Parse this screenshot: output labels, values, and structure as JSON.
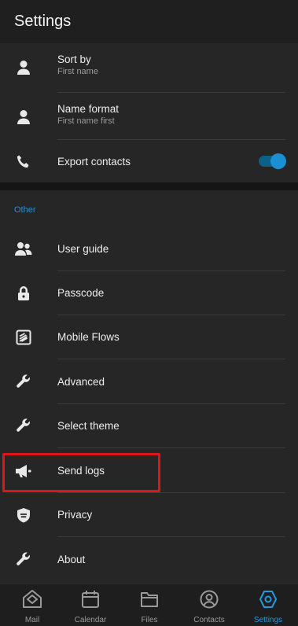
{
  "header": {
    "title": "Settings"
  },
  "contacts_settings": {
    "sort_by": {
      "label": "Sort by",
      "value": "First name"
    },
    "name_format": {
      "label": "Name format",
      "value": "First name first"
    },
    "export_contacts": {
      "label": "Export contacts",
      "enabled": true
    }
  },
  "other": {
    "title": "Other",
    "items": [
      {
        "label": "User guide",
        "icon": "users-icon"
      },
      {
        "label": "Passcode",
        "icon": "lock-icon"
      },
      {
        "label": "Mobile Flows",
        "icon": "mobile-flows-icon"
      },
      {
        "label": "Advanced",
        "icon": "wrench-icon"
      },
      {
        "label": "Select theme",
        "icon": "wrench-icon"
      },
      {
        "label": "Send logs",
        "icon": "megaphone-icon"
      },
      {
        "label": "Privacy",
        "icon": "shield-icon"
      },
      {
        "label": "About",
        "icon": "wrench-icon"
      }
    ]
  },
  "bottom_nav": {
    "items": [
      {
        "label": "Mail",
        "icon": "mail-icon"
      },
      {
        "label": "Calendar",
        "icon": "calendar-icon"
      },
      {
        "label": "Files",
        "icon": "folder-icon"
      },
      {
        "label": "Contacts",
        "icon": "contact-icon"
      },
      {
        "label": "Settings",
        "icon": "settings-icon",
        "active": true
      }
    ]
  },
  "colors": {
    "accent": "#1f9be0",
    "highlight": "#e0141b",
    "background": "#262626"
  }
}
